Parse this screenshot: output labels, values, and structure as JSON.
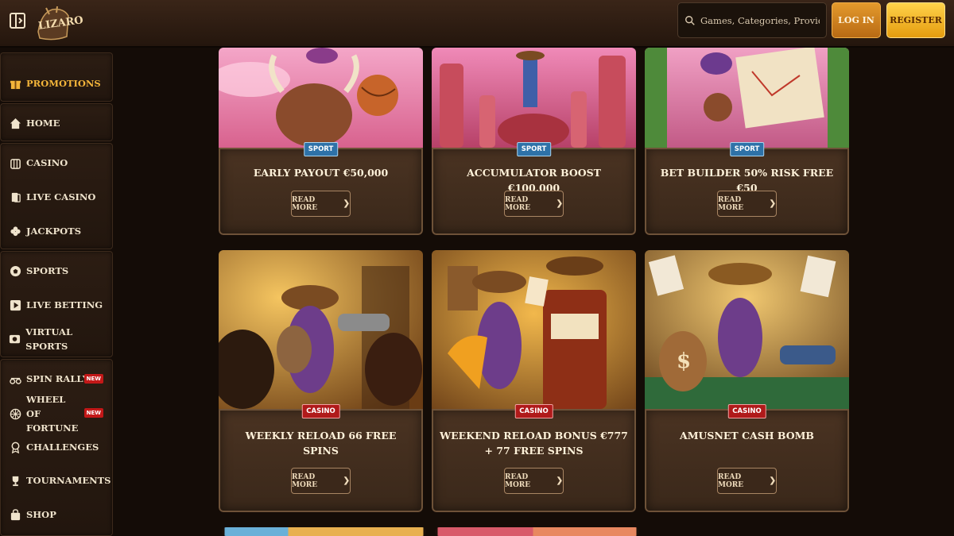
{
  "header": {
    "logo_text": "LIZARO",
    "search_placeholder": "Games, Categories, Providers",
    "login_label": "LOG IN",
    "register_label": "REGISTER"
  },
  "sidebar": {
    "items": [
      {
        "label": "PROMOTIONS",
        "icon": "gift-icon"
      },
      {
        "label": "HOME",
        "icon": "home-icon"
      },
      {
        "label": "CASINO",
        "icon": "casino-icon"
      },
      {
        "label": "LIVE CASINO",
        "icon": "cards-icon"
      },
      {
        "label": "JACKPOTS",
        "icon": "clover-icon"
      },
      {
        "label": "SPORTS",
        "icon": "ball-icon"
      },
      {
        "label": "LIVE BETTING",
        "icon": "play-icon"
      },
      {
        "label": "VIRTUAL SPORTS",
        "icon": "virtual-icon"
      },
      {
        "label": "SPIN RALLY",
        "icon": "rally-icon",
        "badge": "NEW"
      },
      {
        "label": "WHEEL OF FORTUNE",
        "icon": "wheel-icon",
        "badge": "NEW"
      },
      {
        "label": "CHALLENGES",
        "icon": "medal-icon"
      },
      {
        "label": "TOURNAMENTS",
        "icon": "trophy-icon"
      },
      {
        "label": "SHOP",
        "icon": "bag-icon"
      }
    ]
  },
  "cards": [
    {
      "tag": "SPORT",
      "title": "EARLY PAYOUT €50,000",
      "cta": "READ MORE"
    },
    {
      "tag": "SPORT",
      "title": "ACCUMULATOR BOOST €100,000",
      "cta": "READ MORE"
    },
    {
      "tag": "SPORT",
      "title": "BET BUILDER 50% RISK FREE €50",
      "cta": "READ MORE"
    },
    {
      "tag": "CASINO",
      "title": "WEEKLY RELOAD 66 FREE SPINS",
      "cta": "READ MORE"
    },
    {
      "tag": "CASINO",
      "title": "WEEKEND RELOAD BONUS €777 + 77 FREE SPINS",
      "cta": "READ MORE"
    },
    {
      "tag": "CASINO",
      "title": "AMUSNET CASH BOMB",
      "cta": "READ MORE"
    }
  ],
  "colors": {
    "accent_orange": "#e49a2c",
    "register_yellow": "#ffd24a",
    "sport_tag": "#2e72a8",
    "casino_tag": "#b01a1a",
    "promo_text": "#f3b53a"
  }
}
